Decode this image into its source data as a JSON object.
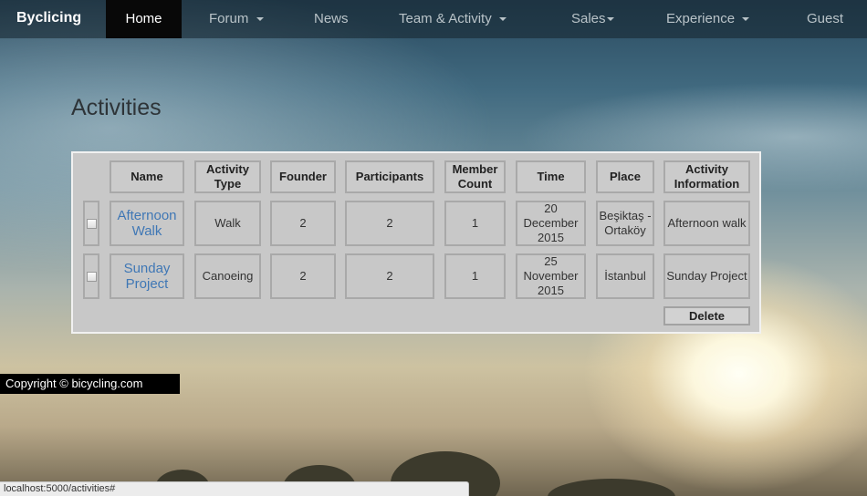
{
  "navbar": {
    "brand": "Byclicing",
    "items": [
      {
        "label": "Home"
      },
      {
        "label": "Forum"
      },
      {
        "label": "News"
      },
      {
        "label": "Team & Activity"
      },
      {
        "label": "Sales"
      },
      {
        "label": "Experience"
      },
      {
        "label": "Guest"
      }
    ]
  },
  "page": {
    "title": "Activities"
  },
  "table": {
    "headers": [
      "Name",
      "Activity Type",
      "Founder",
      "Participants",
      "Member Count",
      "Time",
      "Place",
      "Activity Information"
    ],
    "rows": [
      {
        "name": "Afternoon Walk",
        "type": "Walk",
        "founder": "2",
        "participants": "2",
        "member_count": "1",
        "time": "20 December 2015",
        "place": "Beşiktaş - Ortaköy",
        "info": "Afternoon walk"
      },
      {
        "name": "Sunday Project",
        "type": "Canoeing",
        "founder": "2",
        "participants": "2",
        "member_count": "1",
        "time": "25 November 2015",
        "place": "İstanbul",
        "info": "Sunday Project"
      }
    ],
    "delete_label": "Delete"
  },
  "footer": {
    "copyright": "Copyright © bicycling.com"
  },
  "status_bar": {
    "url": "localhost:5000/activities#"
  },
  "colors": {
    "link": "#3f77b5",
    "active_nav_bg": "#080808"
  },
  "icons": {
    "dropdown": "chevron-down-icon",
    "checkbox": "checkbox-icon"
  }
}
